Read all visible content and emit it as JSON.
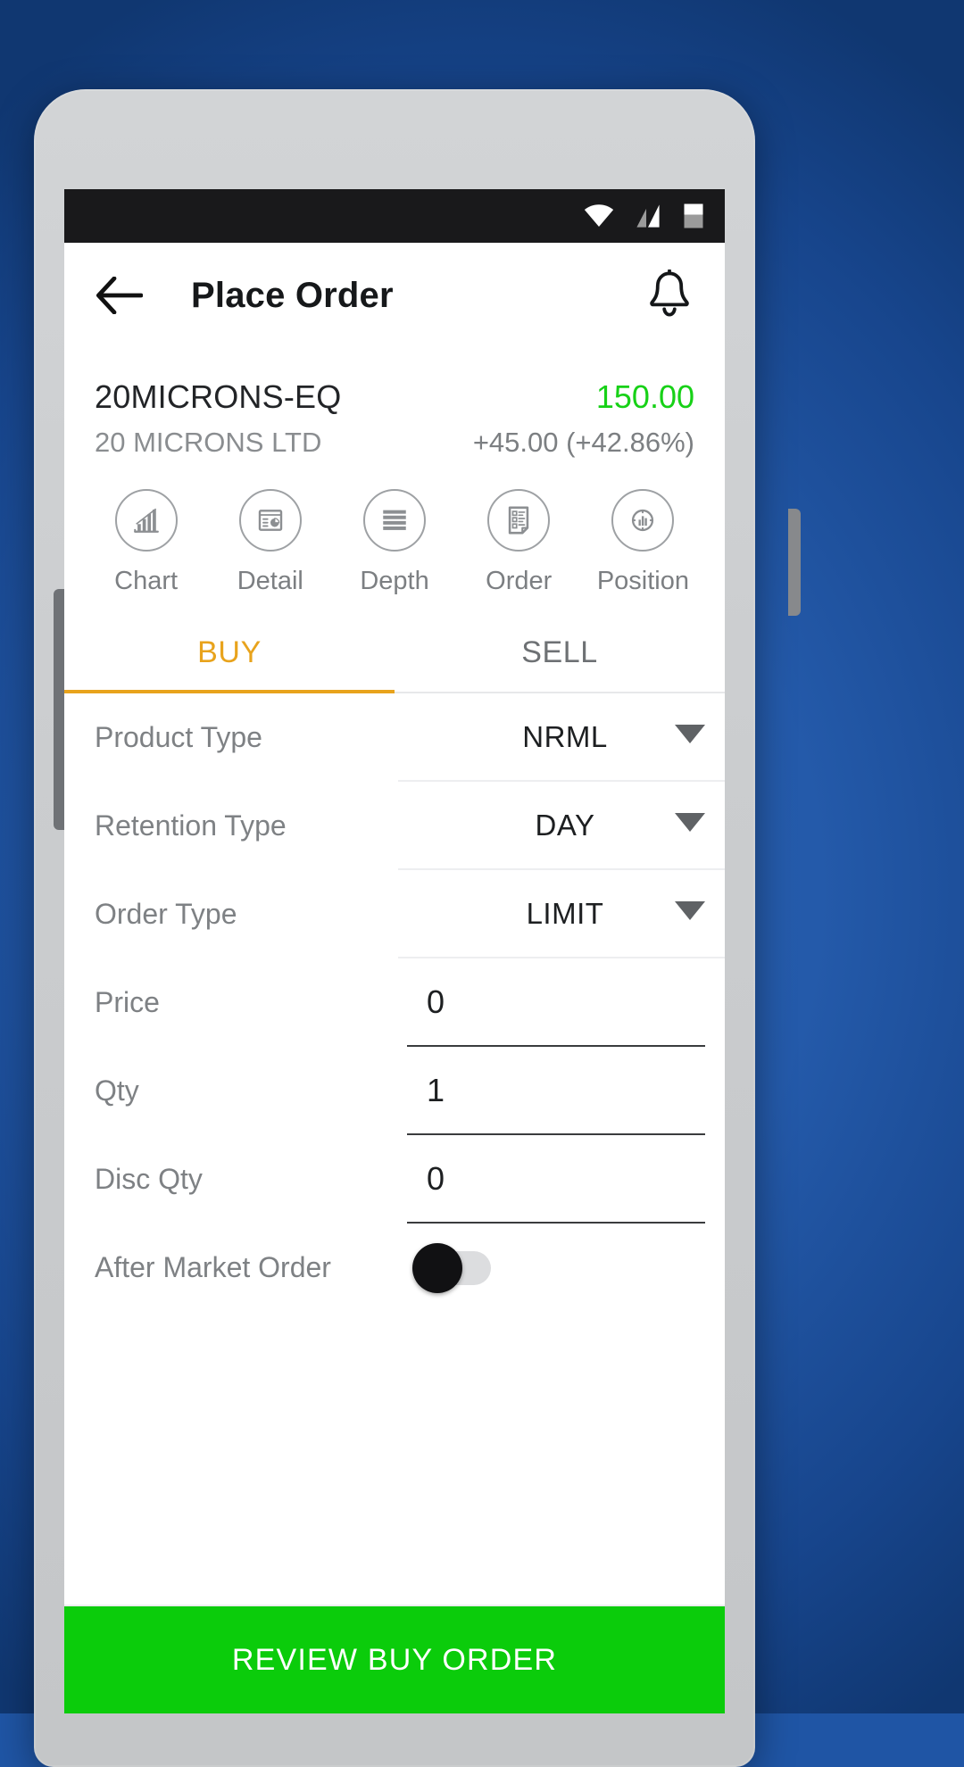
{
  "statusbar": {
    "icons": [
      "wifi-icon",
      "signal-icon",
      "battery-icon"
    ]
  },
  "appbar": {
    "back_icon": "back-arrow-icon",
    "title": "Place Order",
    "bell_icon": "bell-icon"
  },
  "scrip": {
    "symbol": "20MICRONS-EQ",
    "company": "20 MICRONS LTD",
    "ltp": "150.00",
    "change": "+45.00 (+42.86%)",
    "ltp_color": "#17D117"
  },
  "quicknav": [
    {
      "label": "Chart",
      "icon": "bar-chart-icon"
    },
    {
      "label": "Detail",
      "icon": "report-detail-icon"
    },
    {
      "label": "Depth",
      "icon": "market-depth-icon"
    },
    {
      "label": "Order",
      "icon": "order-book-icon"
    },
    {
      "label": "Position",
      "icon": "position-icon"
    }
  ],
  "tabs": {
    "buy": "BUY",
    "sell": "SELL",
    "active": "BUY",
    "active_color": "#E8A31C"
  },
  "form": {
    "rows": [
      {
        "label": "Product Type",
        "value": "NRML",
        "type": "select"
      },
      {
        "label": "Retention Type",
        "value": "DAY",
        "type": "select"
      },
      {
        "label": "Order Type",
        "value": "LIMIT",
        "type": "select"
      },
      {
        "label": "Price",
        "value": "0",
        "type": "input"
      },
      {
        "label": "Qty",
        "value": "1",
        "type": "input"
      },
      {
        "label": "Disc Qty",
        "value": "0",
        "type": "input"
      },
      {
        "label": "After Market Order",
        "value": "off",
        "type": "toggle"
      }
    ]
  },
  "cta": {
    "label": "REVIEW BUY ORDER",
    "color": "#0BCC0B"
  }
}
